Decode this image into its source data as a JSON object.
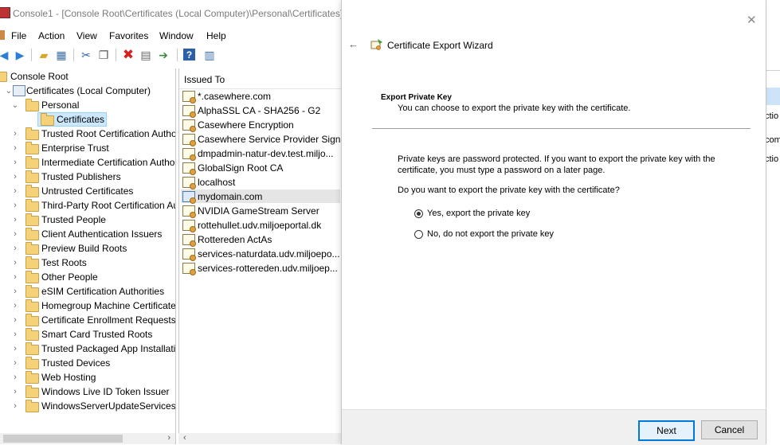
{
  "window": {
    "title": "Console1 - [Console Root\\Certificates (Local Computer)\\Personal\\Certificates]"
  },
  "menu": [
    "File",
    "Action",
    "View",
    "Favorites",
    "Window",
    "Help"
  ],
  "toolbar_icons": [
    "back-arrow-icon",
    "forward-arrow-icon",
    "up-folder-icon",
    "show-hide-tree-icon",
    "cut-icon",
    "copy-icon",
    "delete-icon",
    "properties-icon",
    "export-list-icon",
    "help-icon",
    "action-pane-icon"
  ],
  "tree": {
    "root": "Console Root",
    "computer": "Certificates (Local Computer)",
    "personal": "Personal",
    "certificates": "Certificates",
    "stores": [
      "Trusted Root Certification Autho",
      "Enterprise Trust",
      "Intermediate Certification Autho",
      "Trusted Publishers",
      "Untrusted Certificates",
      "Third-Party Root Certification Au",
      "Trusted People",
      "Client Authentication Issuers",
      "Preview Build Roots",
      "Test Roots",
      "Other People",
      "eSIM Certification Authorities",
      "Homegroup Machine Certificate",
      "Certificate Enrollment Requests",
      "Smart Card Trusted Roots",
      "Trusted Packaged App Installatic",
      "Trusted Devices",
      "Web Hosting",
      "Windows Live ID Token Issuer",
      "WindowsServerUpdateServices"
    ]
  },
  "list": {
    "column_header": "Issued To",
    "items": [
      "*.casewhere.com",
      "AlphaSSL CA - SHA256 - G2",
      "Casewhere Encryption",
      "Casewhere Service Provider Sign...",
      "dmpadmin-natur-dev.test.miljo...",
      "GlobalSign Root CA",
      "localhost",
      "mydomain.com",
      "NVIDIA GameStream Server",
      "rottehullet.udv.miljoeportal.dk",
      "Rottereden ActAs",
      "services-naturdata.udv.miljoepo...",
      "services-rottereden.udv.miljoep..."
    ],
    "selected": "mydomain.com"
  },
  "right_strip": {
    "texts": [
      "ctio",
      "com",
      "ctio"
    ]
  },
  "wizard": {
    "close": "✕",
    "back": "←",
    "title": "Certificate Export Wizard",
    "section_title": "Export Private Key",
    "section_subtitle": "You can choose to export the private key with the certificate.",
    "body": "Private keys are password protected. If you want to export the private key with the certificate, you must type a password on a later page.",
    "question": "Do you want to export the private key with the certificate?",
    "option_yes": "Yes, export the private key",
    "option_no": "No, do not export the private key",
    "selected_option": "yes",
    "next_label": "Next",
    "cancel_label": "Cancel"
  },
  "colors": {
    "selection": "#cce8ff",
    "primary_button_border": "#0078d7",
    "footer_bg": "#f0f0f0"
  }
}
